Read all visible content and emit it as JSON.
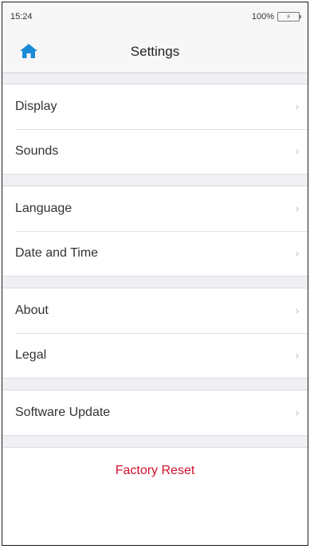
{
  "status_bar": {
    "time": "15:24",
    "battery": "100%"
  },
  "nav": {
    "title": "Settings",
    "home_icon": "home-icon"
  },
  "groups": [
    {
      "items": [
        {
          "label": "Display"
        },
        {
          "label": "Sounds"
        }
      ]
    },
    {
      "items": [
        {
          "label": "Language"
        },
        {
          "label": "Date and Time"
        }
      ]
    },
    {
      "items": [
        {
          "label": "About"
        },
        {
          "label": "Legal"
        }
      ]
    },
    {
      "items": [
        {
          "label": "Software Update"
        }
      ]
    }
  ],
  "reset": {
    "label": "Factory Reset",
    "color": "#d0112b"
  },
  "colors": {
    "accent": "#1a8bd6",
    "background": "#efeff4"
  }
}
